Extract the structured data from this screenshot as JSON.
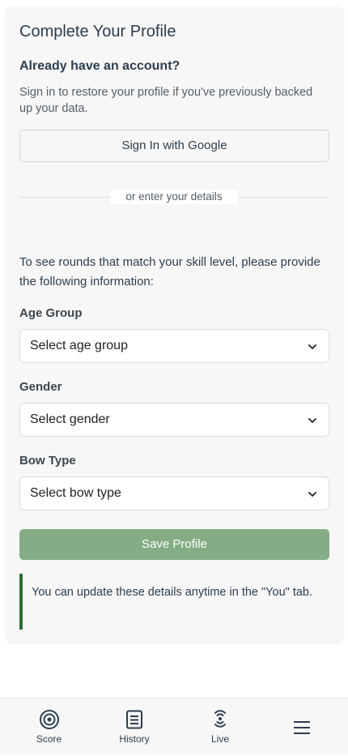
{
  "profile": {
    "title": "Complete Your Profile",
    "account_heading": "Already have an account?",
    "account_desc": "Sign in to restore your profile if you've previously backed up your data.",
    "google_button": "Sign In with Google",
    "divider_text": "or enter your details",
    "info_text": "To see rounds that match your skill level, please provide the following information:",
    "age_label": "Age Group",
    "age_value": "Select age group",
    "gender_label": "Gender",
    "gender_value": "Select gender",
    "bow_label": "Bow Type",
    "bow_value": "Select bow type",
    "save_button": "Save Profile",
    "note": "You can update these details anytime in the \"You\" tab."
  },
  "tabbar": {
    "items": [
      {
        "label": "Score",
        "icon": "target-icon"
      },
      {
        "label": "History",
        "icon": "document-icon"
      },
      {
        "label": "Live",
        "icon": "broadcast-icon"
      },
      {
        "label": "",
        "icon": "menu-icon"
      }
    ]
  },
  "colors": {
    "save_button": "#84ad85",
    "note_border": "#2e6f34",
    "text": "#2c3e50"
  }
}
